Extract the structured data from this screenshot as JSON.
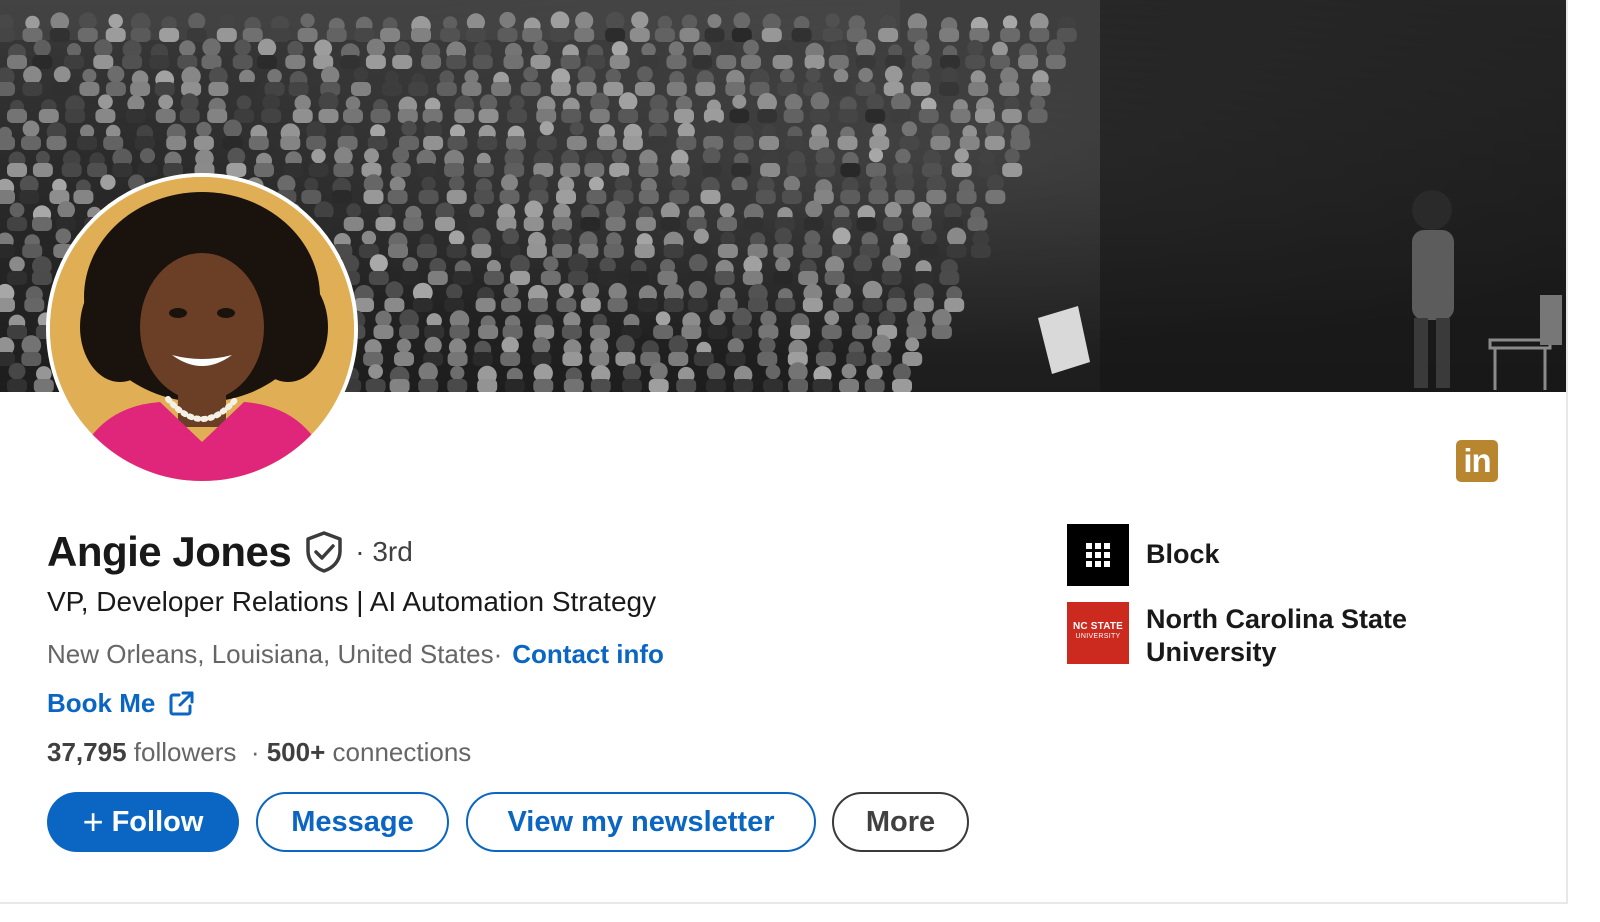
{
  "profile": {
    "name": "Angie Jones",
    "degree": "· 3rd",
    "headline": "VP, Developer Relations | AI Automation Strategy",
    "location": "New Orleans, Louisiana, United States",
    "location_separator": " ·",
    "contact_info": "Contact info",
    "website_label": "Book Me",
    "followers_count": "37,795",
    "followers_label": "followers",
    "connections_separator": "·",
    "connections_count": "500+",
    "connections_label": "connections"
  },
  "actions": {
    "follow_plus": "+",
    "follow_label": "Follow",
    "message_label": "Message",
    "newsletter_label": "View my newsletter",
    "more_label": "More"
  },
  "organizations": [
    {
      "name": "Block",
      "logo": "block-grid-logo"
    },
    {
      "name": "North Carolina State University",
      "logo": "ncsu-logo",
      "logo_text_1": "NC STATE",
      "logo_text_2": "UNIVERSITY"
    }
  ],
  "brand": {
    "logo_text": "in",
    "logo_color": "#b8862f"
  },
  "colors": {
    "accent": "#0a66c2",
    "text_primary": "#191919",
    "text_secondary": "#666666"
  },
  "icons": [
    "verified-shield-icon",
    "external-link-icon",
    "linkedin-logo-icon"
  ]
}
